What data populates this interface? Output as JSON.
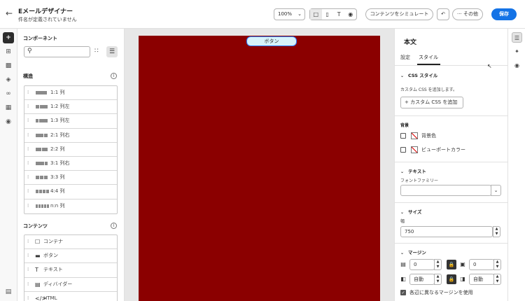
{
  "header": {
    "back_icon": "arrow-left-icon",
    "title": "Eメールデザイナー",
    "subtitle": "件名が定義されていません",
    "zoom": "100%",
    "view_modes": [
      "desktop-icon",
      "mobile-icon",
      "text-icon",
      "preview-icon"
    ],
    "simulate_label": "コンテンツをシミュレート",
    "more_label": "その他",
    "save_label": "保存"
  },
  "left_rail": [
    "plus-icon",
    "structure-icon",
    "assets-icon",
    "layers-icon",
    "link-icon",
    "fragments-icon",
    "personalize-icon",
    "bottom-icon"
  ],
  "components": {
    "title": "コンポーネント",
    "search_placeholder": "",
    "structure_title": "構造",
    "structure_items": [
      {
        "label": "1:1 列",
        "bars": [
          1
        ]
      },
      {
        "label": "1:2 列左",
        "bars": [
          1,
          2
        ]
      },
      {
        "label": "1:3 列左",
        "bars": [
          1,
          3
        ]
      },
      {
        "label": "2:1 列右",
        "bars": [
          2,
          1
        ]
      },
      {
        "label": "2:2 列",
        "bars": [
          1,
          1
        ]
      },
      {
        "label": "3:1 列右",
        "bars": [
          3,
          1
        ]
      },
      {
        "label": "3:3 列",
        "bars": [
          1,
          1,
          1
        ]
      },
      {
        "label": "4:4 列",
        "bars": [
          1,
          1,
          1,
          1
        ]
      },
      {
        "label": "n:n 列",
        "bars": [
          1,
          1,
          1,
          1,
          1
        ]
      }
    ],
    "content_title": "コンテンツ",
    "content_items": [
      {
        "label": "コンテナ",
        "icon": "container-icon"
      },
      {
        "label": "ボタン",
        "icon": "button-icon"
      },
      {
        "label": "テキスト",
        "icon": "text-icon"
      },
      {
        "label": "ディバイダー",
        "icon": "divider-icon"
      },
      {
        "label": "HTML",
        "icon": "html-icon"
      }
    ]
  },
  "canvas": {
    "bg_color": "#8b0000",
    "button_label": "ボタン"
  },
  "properties": {
    "title": "本文",
    "tabs": [
      "設定",
      "スタイル"
    ],
    "active_tab": "スタイル",
    "css_section": "CSS スタイル",
    "css_note": "カスタム CSS を追加します。",
    "add_css_label": "カスタム CSS を追加",
    "background_section": "背景",
    "bg_color_label": "背景色",
    "viewport_color_label": "ビューポートカラー",
    "text_section": "テキスト",
    "font_family_label": "フォントファミリー",
    "font_family_value": "",
    "size_section": "サイズ",
    "width_label": "幅",
    "width_value": "750",
    "margin_section": "マージン",
    "margin_top": "0",
    "margin_bottom": "0",
    "margin_left": "自動",
    "margin_right": "自動",
    "different_margins_label": "各辺に異なるマージンを使用",
    "different_margins_checked": true
  },
  "right_rail": [
    "properties-icon",
    "ai-icon",
    "validation-icon"
  ]
}
